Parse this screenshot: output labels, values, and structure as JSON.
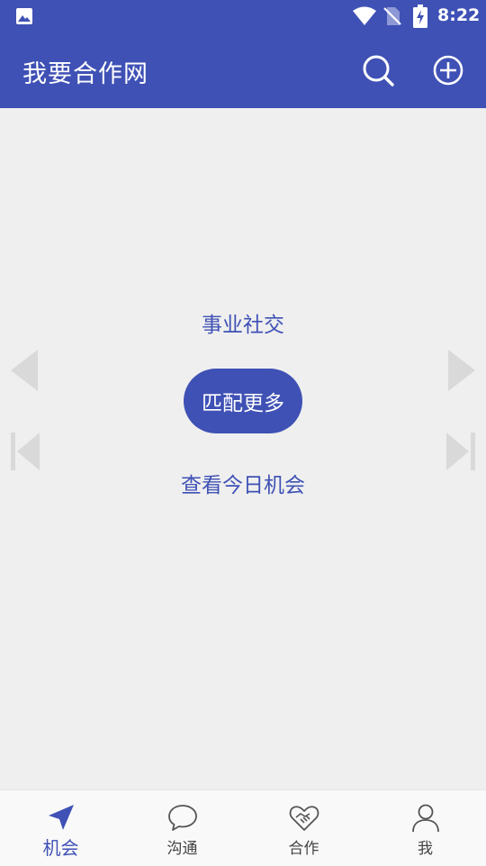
{
  "status_bar": {
    "time": "8:22",
    "icons": [
      "gallery-icon",
      "wifi-icon",
      "no-sim-icon",
      "battery-charging-icon"
    ]
  },
  "app_bar": {
    "title": "我要合作网",
    "actions": [
      "search-icon",
      "add-circle-icon"
    ]
  },
  "main": {
    "social_label": "事业社交",
    "match_button": "匹配更多",
    "today_link": "查看今日机会"
  },
  "bottom_nav": {
    "items": [
      {
        "label": "机会",
        "icon": "send-icon",
        "active": true
      },
      {
        "label": "沟通",
        "icon": "chat-bubble-icon",
        "active": false
      },
      {
        "label": "合作",
        "icon": "handshake-heart-icon",
        "active": false
      },
      {
        "label": "我",
        "icon": "person-icon",
        "active": false
      }
    ]
  },
  "colors": {
    "primary": "#3f51b5",
    "background": "#efefef",
    "nav_background": "#f9f9f9",
    "arrow": "#d9d9d9"
  }
}
